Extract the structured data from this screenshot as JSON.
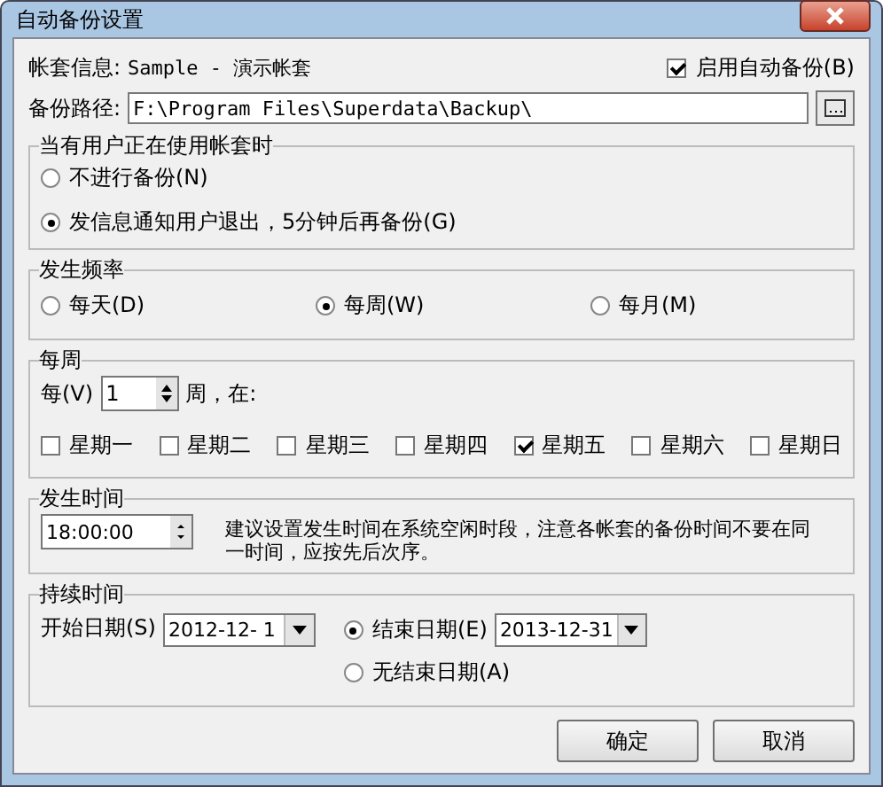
{
  "window": {
    "title": "自动备份设置"
  },
  "account": {
    "label": "帐套信息:",
    "value": "Sample - 演示帐套"
  },
  "enable_backup": {
    "label": "启用自动备份(B)",
    "checked": true
  },
  "path": {
    "label": "备份路径:",
    "value": "F:\\Program Files\\Superdata\\Backup\\"
  },
  "in_use": {
    "title": "当有用户正在使用帐套时",
    "options": [
      {
        "label": "不进行备份(N)",
        "selected": false
      },
      {
        "label": "发信息通知用户退出，5分钟后再备份(G)",
        "selected": true
      }
    ]
  },
  "frequency": {
    "title": "发生频率",
    "options": [
      {
        "label": "每天(D)",
        "selected": false
      },
      {
        "label": "每周(W)",
        "selected": true
      },
      {
        "label": "每月(M)",
        "selected": false
      }
    ]
  },
  "weekly": {
    "title": "每周",
    "every_label": "每(V)",
    "every_value": "1",
    "unit": "周，在:",
    "days": [
      {
        "label": "星期一",
        "checked": false
      },
      {
        "label": "星期二",
        "checked": false
      },
      {
        "label": "星期三",
        "checked": false
      },
      {
        "label": "星期四",
        "checked": false
      },
      {
        "label": "星期五",
        "checked": true
      },
      {
        "label": "星期六",
        "checked": false
      },
      {
        "label": "星期日",
        "checked": false
      }
    ]
  },
  "time": {
    "title": "发生时间",
    "value": "18:00:00",
    "note": "建议设置发生时间在系统空闲时段，注意各帐套的备份时间不要在同一时间，应按先后次序。"
  },
  "duration": {
    "title": "持续时间",
    "start_label": "开始日期(S)",
    "start_value": "2012-12- 1",
    "end_options": [
      {
        "label": "结束日期(E)",
        "selected": true,
        "value": "2013-12-31"
      },
      {
        "label": "无结束日期(A)",
        "selected": false
      }
    ]
  },
  "buttons": [
    "确定",
    "取消"
  ]
}
